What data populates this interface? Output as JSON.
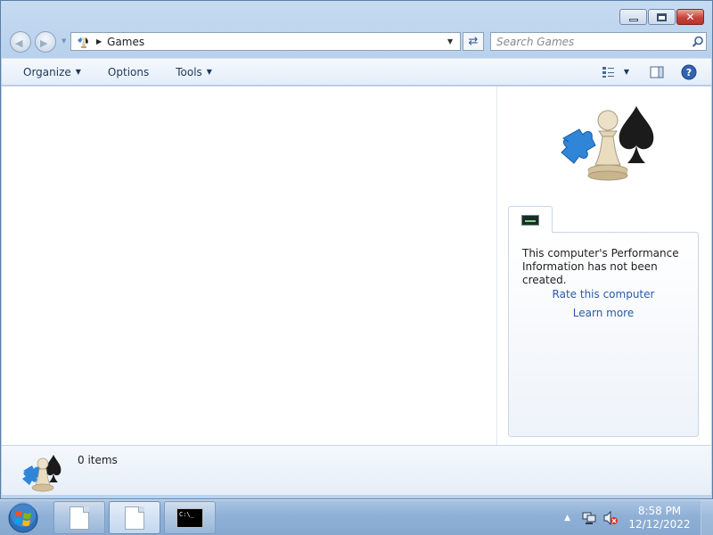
{
  "window": {
    "caption_buttons": {
      "minimize_icon": "minimize-icon",
      "maximize_icon": "maximize-icon",
      "close_glyph": "✕"
    }
  },
  "navbar": {
    "back_icon": "back-arrow-icon",
    "forward_icon": "forward-arrow-icon",
    "address_text": "Games",
    "refresh_icon": "refresh-icon",
    "search_placeholder": "Search Games"
  },
  "command_bar": {
    "organize": "Organize",
    "options": "Options",
    "tools": "Tools"
  },
  "preview": {
    "message": "This computer's Performance Information has not been created.",
    "rate_link": "Rate this computer",
    "learn_link": "Learn more"
  },
  "details": {
    "items_count": "0 items"
  },
  "taskbar": {
    "time": "8:58 PM",
    "date": "12/12/2022",
    "cmd_text": "C:\\_"
  },
  "colors": {
    "link": "#2a5aa8",
    "close_button": "#c5443b",
    "taskbar": "#8fb0d6"
  }
}
